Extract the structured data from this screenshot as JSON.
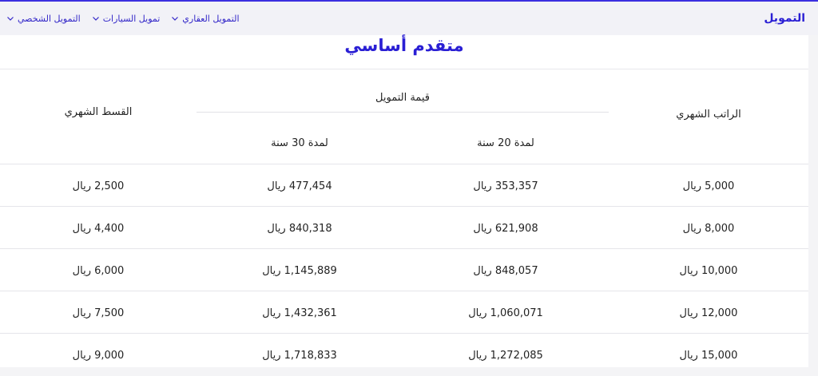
{
  "nav": {
    "brand": "التمويل",
    "items": [
      {
        "label": "التمويل العقاري"
      },
      {
        "label": "تمويل السيارات"
      },
      {
        "label": "التمويل الشخصي"
      }
    ]
  },
  "section": {
    "title": "متقدم أساسي"
  },
  "table": {
    "headers": {
      "salary": "الراتب الشهري",
      "financing_group": "قيمة التمويل",
      "term_20": "لمدة 20 سنة",
      "term_30": "لمدة 30 سنة",
      "installment": "القسط الشهري"
    },
    "rows": [
      {
        "salary": "5,000 ريال",
        "term_20": "353,357 ريال",
        "term_30": "477,454 ريال",
        "installment": "2,500 ريال"
      },
      {
        "salary": "8,000 ريال",
        "term_20": "621,908 ريال",
        "term_30": "840,318 ريال",
        "installment": "4,400 ريال"
      },
      {
        "salary": "10,000 ريال",
        "term_20": "848,057 ريال",
        "term_30": "1,145,889 ريال",
        "installment": "6,000 ريال"
      },
      {
        "salary": "12,000 ريال",
        "term_20": "1,060,071 ريال",
        "term_30": "1,432,361 ريال",
        "installment": "7,500 ريال"
      },
      {
        "salary": "15,000 ريال",
        "term_20": "1,272,085 ريال",
        "term_30": "1,718,833 ريال",
        "installment": "9,000 ريال"
      }
    ]
  },
  "colors": {
    "accent": "#2a1fd4",
    "nav_link": "#3226c8"
  }
}
